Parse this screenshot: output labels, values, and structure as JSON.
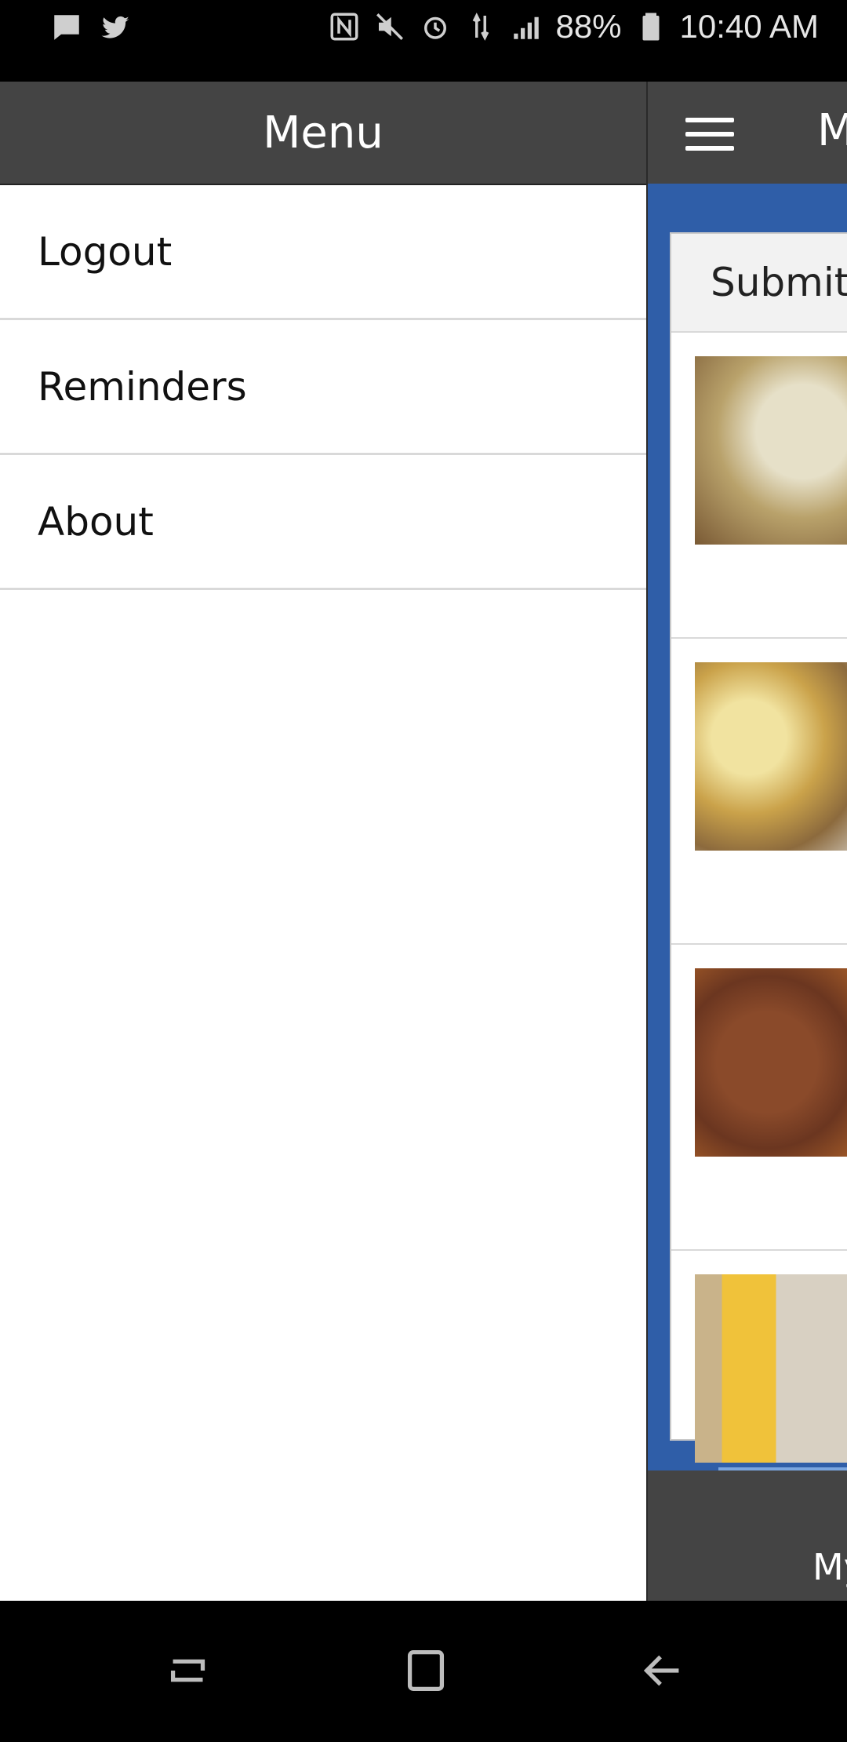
{
  "status_bar": {
    "battery": "88%",
    "time": "10:40 AM",
    "left_icons": [
      "message-icon",
      "twitter-icon"
    ],
    "right_icons": [
      "nfc-icon",
      "mute-icon",
      "alarm-icon",
      "4g-lte-icon",
      "signal-icon",
      "battery-icon"
    ]
  },
  "drawer": {
    "title": "Menu",
    "items": [
      {
        "label": "Logout"
      },
      {
        "label": "Reminders"
      },
      {
        "label": "About"
      }
    ]
  },
  "app": {
    "title_partial": "M",
    "card_header_partial": "Submitt",
    "bottom_tab_partial": "My"
  },
  "nav_bar": {
    "buttons": [
      "recent-apps-icon",
      "home-icon",
      "back-icon"
    ]
  },
  "colors": {
    "toolbar": "#444444",
    "app_background": "#2f5ea8",
    "drawer_background": "#ffffff"
  }
}
